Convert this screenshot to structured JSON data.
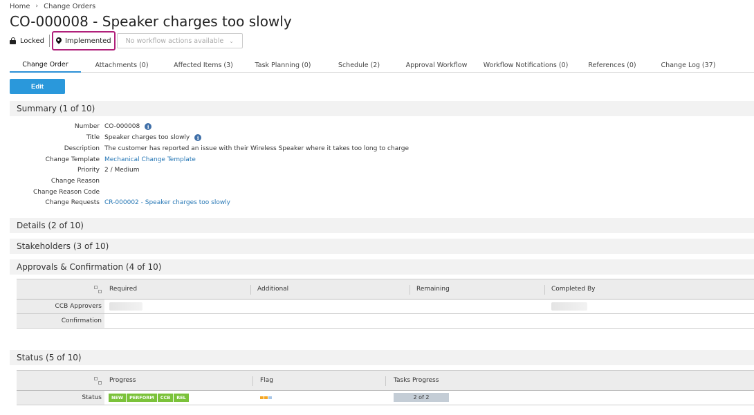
{
  "breadcrumb": {
    "home": "Home",
    "separator": "›",
    "current": "Change Orders"
  },
  "page_title": "CO-000008 - Speaker charges too slowly",
  "status_bar": {
    "lock_label": "Locked",
    "state_label": "Implemented",
    "workflow_label": "No workflow actions available",
    "workflow_chevron": "⌄"
  },
  "tabs": [
    {
      "label": "Change Order",
      "active": true
    },
    {
      "label": "Attachments (0)"
    },
    {
      "label": "Affected Items (3)"
    },
    {
      "label": "Task Planning (0)"
    },
    {
      "label": "Schedule (2)"
    },
    {
      "label": "Approval Workflow"
    },
    {
      "label": "Workflow Notifications (0)"
    },
    {
      "label": "References (0)"
    },
    {
      "label": "Change Log (37)"
    }
  ],
  "edit_label": "Edit",
  "sections": {
    "summary": "Summary (1 of 10)",
    "details": "Details (2 of 10)",
    "stakeholders": "Stakeholders (3 of 10)",
    "approvals": "Approvals & Confirmation (4 of 10)",
    "status": "Status (5 of 10)"
  },
  "summary_fields": {
    "number": {
      "label": "Number",
      "value": "CO-000008"
    },
    "title": {
      "label": "Title",
      "value": "Speaker charges too slowly"
    },
    "description": {
      "label": "Description",
      "value": "The customer has reported an issue with their Wireless Speaker where it takes too long to charge"
    },
    "change_template": {
      "label": "Change Template",
      "value": "Mechanical Change Template"
    },
    "priority": {
      "label": "Priority",
      "value": "2 / Medium"
    },
    "change_reason": {
      "label": "Change Reason",
      "value": ""
    },
    "change_reason_code": {
      "label": "Change Reason Code",
      "value": ""
    },
    "change_requests": {
      "label": "Change Requests",
      "value": "CR-000002 - Speaker charges too slowly"
    }
  },
  "info_glyph": "i",
  "approvals_table": {
    "columns": [
      "Required",
      "Additional",
      "Remaining",
      "Completed By"
    ],
    "rows": [
      "CCB Approvers",
      "Confirmation"
    ]
  },
  "status_table": {
    "columns": [
      "Progress",
      "Flag",
      "Tasks Progress"
    ],
    "row_label": "Status",
    "progress_badges": [
      "NEW",
      "PERFORM",
      "CCB",
      "REL"
    ],
    "tasks_progress": "2 of 2"
  },
  "colors": {
    "accent": "#2a98db",
    "state_border": "#b0207a",
    "link": "#2677b5",
    "badge_green": "#7bc23a",
    "flag_orange": "#f5a623",
    "flag_blue": "#a9c7e8"
  }
}
